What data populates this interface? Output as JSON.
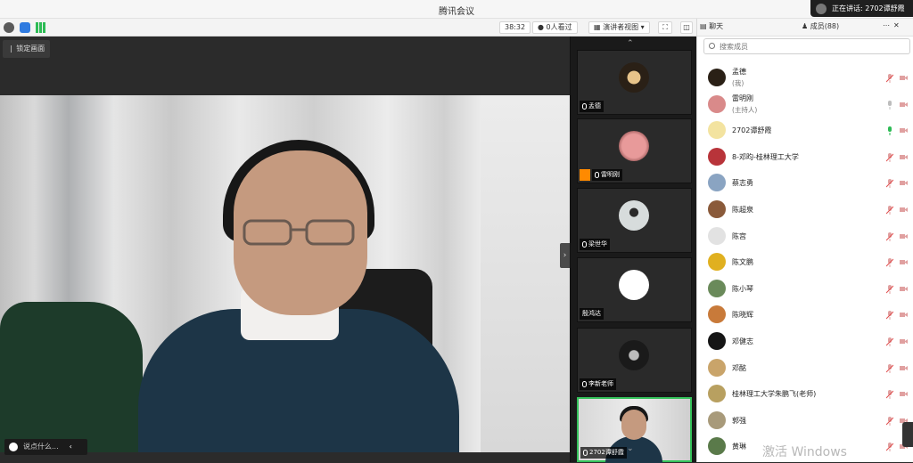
{
  "window": {
    "title": "腾讯会议"
  },
  "speaking": {
    "label": "正在讲话: 2702谭舒霞"
  },
  "toolbar": {
    "timer": "38:32",
    "viewers": "0人看过",
    "view_mode": "演讲者视图"
  },
  "stage": {
    "pin_label": "锁定画面",
    "chat_placeholder": "说点什么..."
  },
  "thumbnails": [
    {
      "name": "孟德",
      "avatar_color": "#2a2016"
    },
    {
      "name": "雷明刚",
      "avatar_color": "#d98a8a"
    },
    {
      "name": "梁世华",
      "avatar_color": "#cfd6d8"
    },
    {
      "name": "殷鸿达",
      "avatar_color": "#ffffff"
    },
    {
      "name": "李新老师",
      "avatar_color": "#1a1a1a"
    },
    {
      "name": "2702谭舒霞",
      "avatar_color": ""
    }
  ],
  "panel": {
    "tab_chat": "聊天",
    "tab_members": "成员(88)",
    "search_placeholder": "搜索成员"
  },
  "members": [
    {
      "name": "孟德",
      "role": "(我)",
      "avatar_color": "#2a2016",
      "mic": "muted"
    },
    {
      "name": "雷明刚",
      "role": "(主持人)",
      "avatar_color": "#d98a8a",
      "mic": "idle"
    },
    {
      "name": "2702谭舒霞",
      "role": "",
      "avatar_color": "#f3e3a0",
      "mic": "active"
    },
    {
      "name": "8-邓昀-桂林理工大学",
      "role": "",
      "avatar_color": "#b8343a",
      "mic": "muted"
    },
    {
      "name": "蔡志勇",
      "role": "",
      "avatar_color": "#8aa4c2",
      "mic": "muted"
    },
    {
      "name": "陈超泉",
      "role": "",
      "avatar_color": "#8a5a3a",
      "mic": "muted"
    },
    {
      "name": "陈宫",
      "role": "",
      "avatar_color": "#e2e2e2",
      "mic": "muted"
    },
    {
      "name": "陈文鹏",
      "role": "",
      "avatar_color": "#e0b020",
      "mic": "muted"
    },
    {
      "name": "陈小琴",
      "role": "",
      "avatar_color": "#6a8a5a",
      "mic": "muted"
    },
    {
      "name": "陈晓辉",
      "role": "",
      "avatar_color": "#c87a3a",
      "mic": "muted"
    },
    {
      "name": "邓健志",
      "role": "",
      "avatar_color": "#151515",
      "mic": "muted"
    },
    {
      "name": "邓酩",
      "role": "",
      "avatar_color": "#c9a46a",
      "mic": "muted"
    },
    {
      "name": "桂林理工大学朱鹏飞(老师)",
      "role": "",
      "avatar_color": "#b8a060",
      "mic": "muted"
    },
    {
      "name": "郭强",
      "role": "",
      "avatar_color": "#a89a7a",
      "mic": "muted"
    },
    {
      "name": "黄琳",
      "role": "",
      "avatar_color": "#5a7a4a",
      "mic": "muted"
    }
  ],
  "watermark": "激活 Windows"
}
